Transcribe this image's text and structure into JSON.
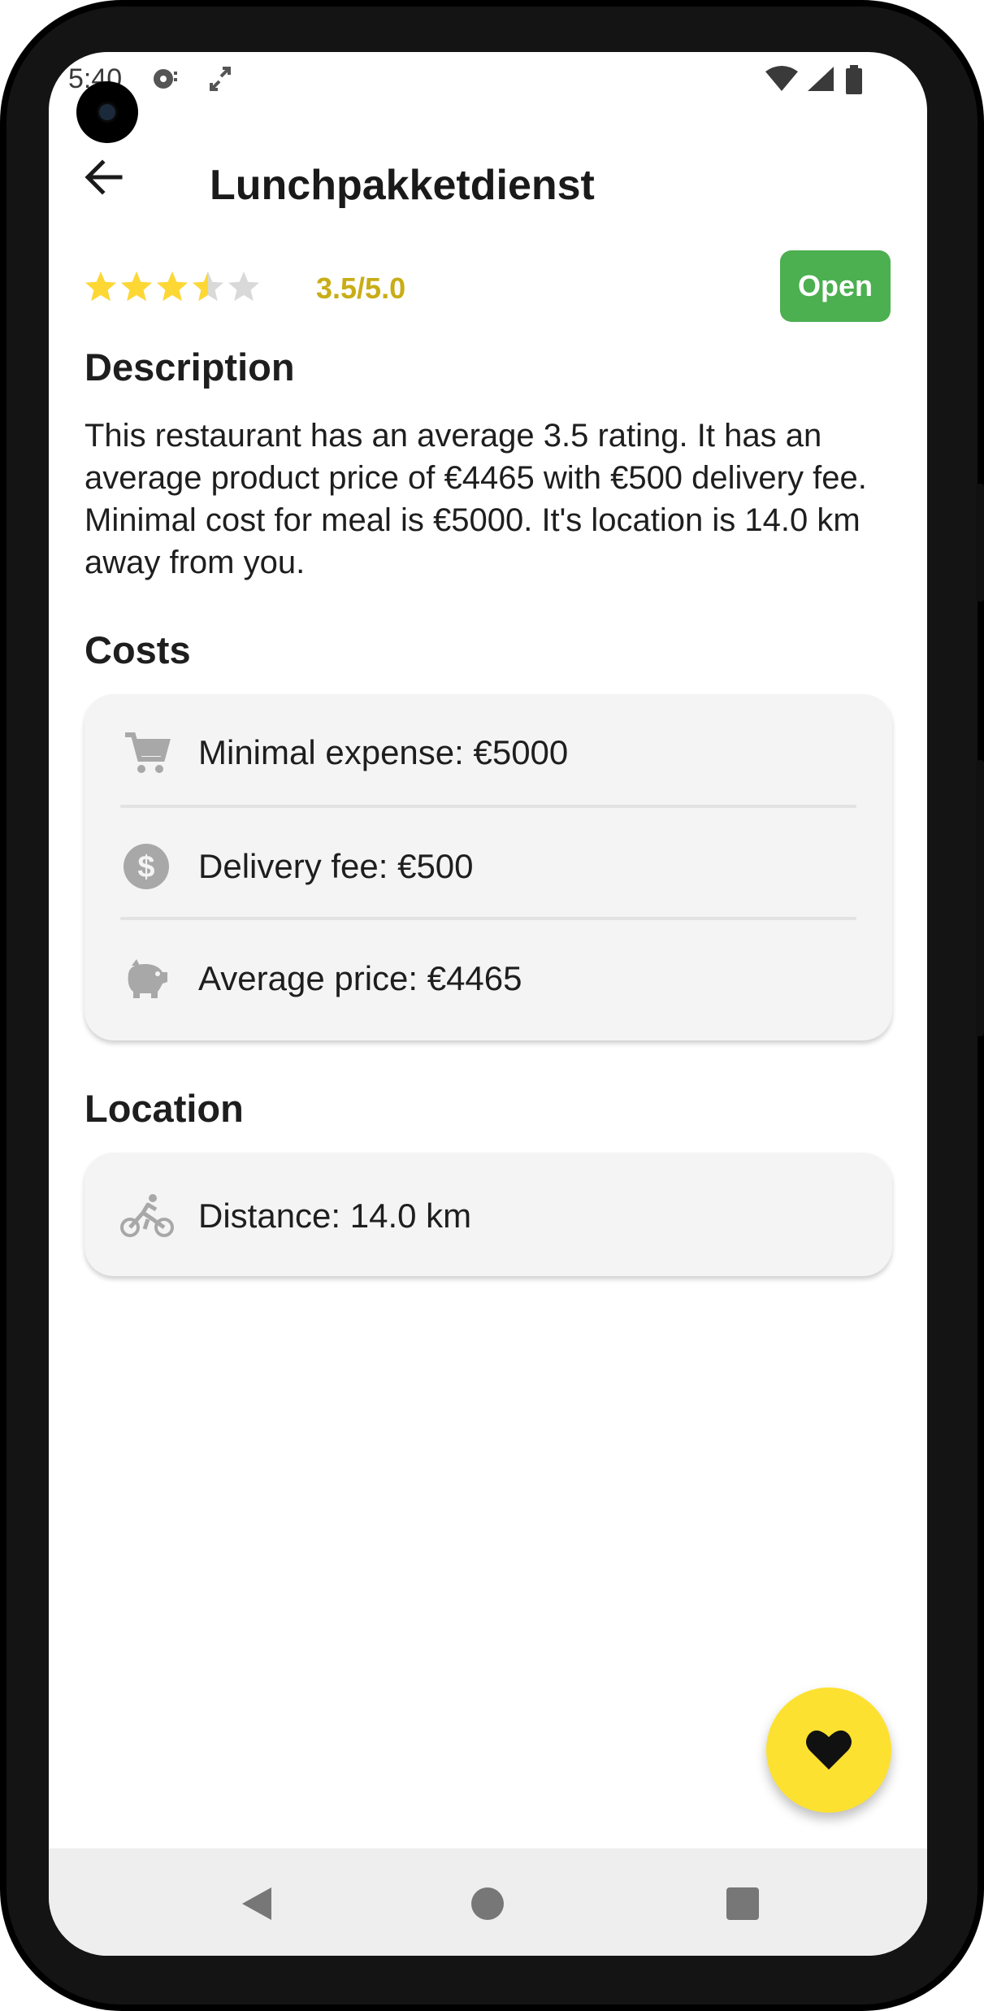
{
  "status_bar": {
    "time": "5:40",
    "icons": [
      "media-notification-icon",
      "expand-icon",
      "wifi-icon",
      "signal-icon",
      "battery-icon"
    ]
  },
  "app_bar": {
    "back_icon": "arrow-back-icon",
    "title": "Lunchpakketdienst"
  },
  "rating": {
    "value": 3.5,
    "max": 5,
    "text": "3.5/5.0",
    "star_color": "#fdd835",
    "empty_star_color": "#d9d9d9"
  },
  "status_badge": {
    "label": "Open",
    "color": "#4caf50"
  },
  "description": {
    "heading": "Description",
    "text": "This restaurant has an average 3.5 rating. It has an average product price of €4465 with €500 delivery fee. Minimal cost for meal is €5000. It's location is 14.0 km away from you."
  },
  "costs": {
    "heading": "Costs",
    "items": [
      {
        "icon": "shopping-cart-icon",
        "label": "Minimal expense: €5000"
      },
      {
        "icon": "dollar-coin-icon",
        "label": "Delivery fee: €500"
      },
      {
        "icon": "piggy-bank-icon",
        "label": "Average price: €4465"
      }
    ]
  },
  "location": {
    "heading": "Location",
    "items": [
      {
        "icon": "bike-icon",
        "label": "Distance: 14.0 km"
      }
    ]
  },
  "fab": {
    "icon": "heart-icon",
    "color": "#fde130"
  },
  "nav_bar": {
    "buttons": [
      "nav-back-icon",
      "nav-home-icon",
      "nav-recents-icon"
    ]
  }
}
